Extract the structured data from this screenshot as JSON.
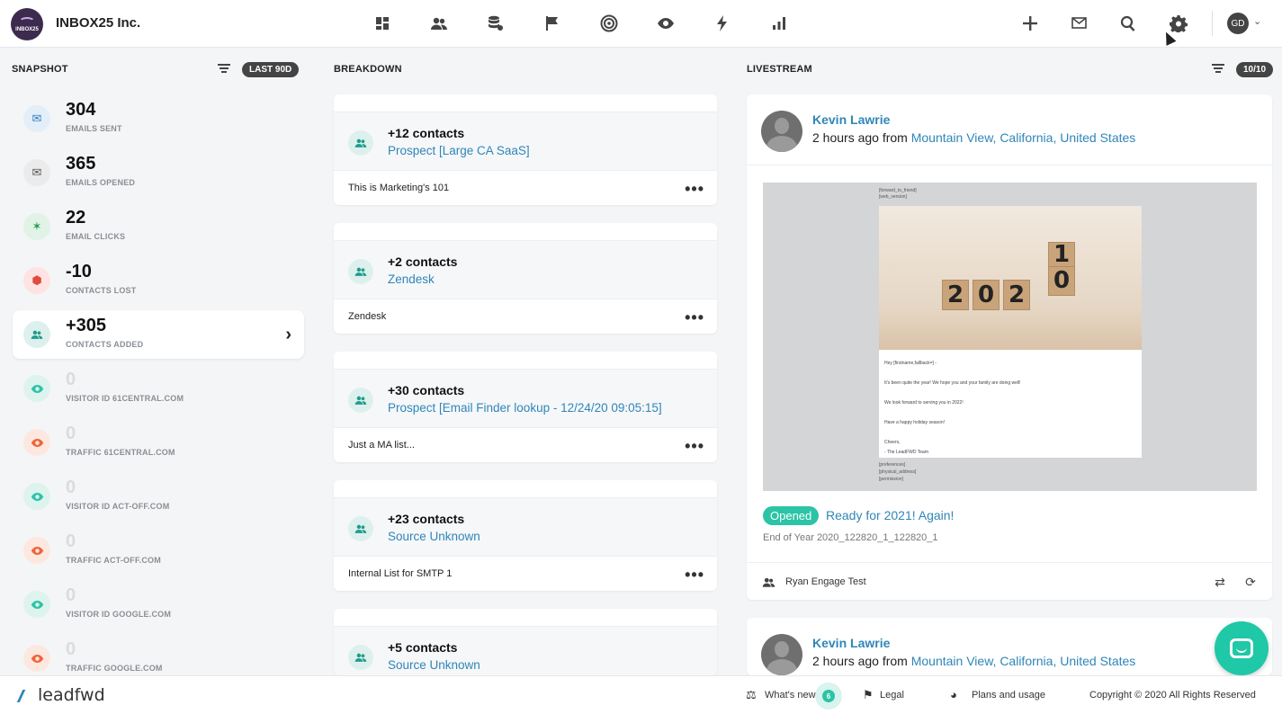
{
  "header": {
    "logo_text": "INBOX25",
    "company": "INBOX25 Inc.",
    "avatar_initials": "GD"
  },
  "snapshot": {
    "title": "SNAPSHOT",
    "range_pill": "LAST 90D",
    "items": [
      {
        "value": "304",
        "label": "EMAILS SENT",
        "icon": "envelope-icon"
      },
      {
        "value": "365",
        "label": "EMAILS OPENED",
        "icon": "envelope-open-icon"
      },
      {
        "value": "22",
        "label": "EMAIL CLICKS",
        "icon": "cursor-click-icon"
      },
      {
        "value": "-10",
        "label": "CONTACTS LOST",
        "icon": "contacts-lost-icon"
      },
      {
        "value": "+305",
        "label": "CONTACTS ADDED",
        "icon": "users-icon"
      },
      {
        "value": "0",
        "label": "VISITOR ID 61CENTRAL.COM",
        "icon": "eye-icon"
      },
      {
        "value": "0",
        "label": "TRAFFIC 61CENTRAL.COM",
        "icon": "eye-icon"
      },
      {
        "value": "0",
        "label": "VISITOR ID ACT-OFF.COM",
        "icon": "eye-icon"
      },
      {
        "value": "0",
        "label": "TRAFFIC ACT-OFF.COM",
        "icon": "eye-icon"
      },
      {
        "value": "0",
        "label": "VISITOR ID GOOGLE.COM",
        "icon": "eye-icon"
      },
      {
        "value": "0",
        "label": "TRAFFIC GOOGLE.COM",
        "icon": "eye-icon"
      }
    ]
  },
  "breakdown": {
    "title": "BREAKDOWN",
    "cards": [
      {
        "count": "+12 contacts",
        "source": "Prospect [Large CA SaaS]",
        "note": "This is Marketing's 101"
      },
      {
        "count": "+2 contacts",
        "source": "Zendesk",
        "note": "Zendesk"
      },
      {
        "count": "+30 contacts",
        "source": "Prospect [Email Finder lookup - 12/24/20 09:05:15]",
        "note": "Just a MA list..."
      },
      {
        "count": "+23 contacts",
        "source": "Source Unknown",
        "note": "Internal List for SMTP 1"
      },
      {
        "count": "+5 contacts",
        "source": "Source Unknown",
        "note": ""
      }
    ]
  },
  "livestream": {
    "title": "LIVESTREAM",
    "count_pill": "10/10",
    "entries": [
      {
        "name": "Kevin Lawrie",
        "time_prefix": "2 hours ago from ",
        "location": "Mountain View, California, United States",
        "status": "Opened",
        "subject": "Ready for 2021! Again!",
        "campaign": "End of Year 2020_122820_1_122820_1",
        "list": "Ryan Engage Test",
        "email_preview": {
          "top_meta": [
            "[forward_to_friend]",
            "[web_version]"
          ],
          "lines": [
            "Hey [firstname,fallback=] -",
            "It's been quite the year! We hope you and your family are doing well!",
            "We look forward to serving you in 2022!",
            "Have a happy holiday season!",
            "Cheers,",
            "- The LeadFWD Team"
          ],
          "bottom_meta": [
            "[preferences]",
            "[physical_address]",
            "[permission]"
          ],
          "blocks": [
            "2",
            "0",
            "2",
            "0",
            "1"
          ]
        }
      },
      {
        "name": "Kevin Lawrie",
        "time_prefix": "2 hours ago from ",
        "location": "Mountain View, California, United States"
      }
    ]
  },
  "footer": {
    "brand": "leadfwd",
    "whats_new": "What's new",
    "whats_new_count": "6",
    "legal": "Legal",
    "plans": "Plans and usage",
    "copyright": "Copyright © 2020 All Rights Reserved"
  }
}
